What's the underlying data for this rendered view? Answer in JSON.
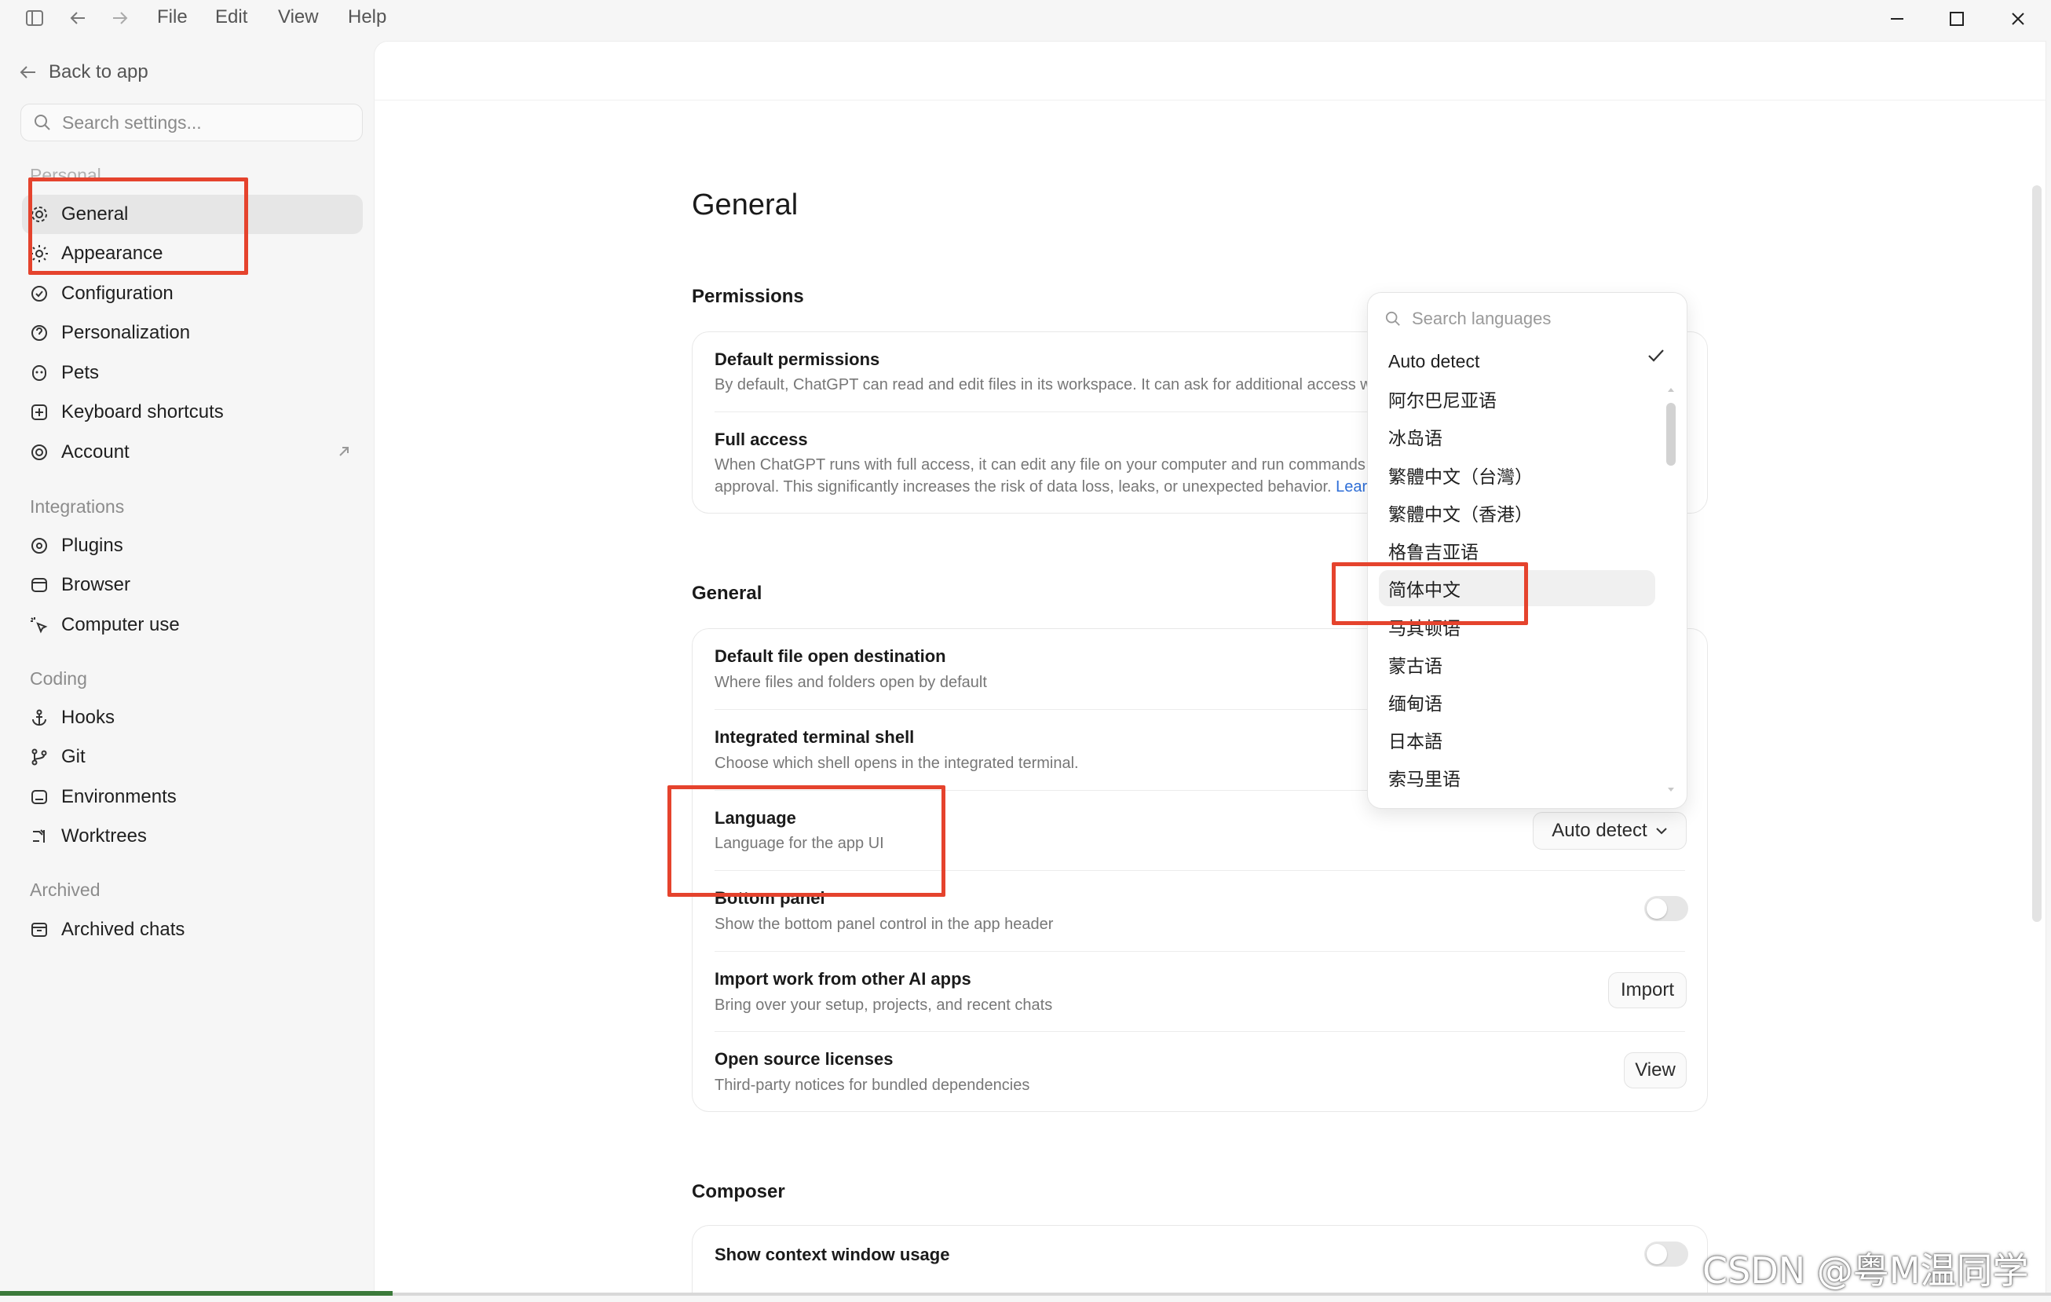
{
  "menu": {
    "file": "File",
    "edit": "Edit",
    "view": "View",
    "help": "Help"
  },
  "sidebar": {
    "back_label": "Back to app",
    "search_placeholder": "Search settings...",
    "sections": {
      "personal": "Personal",
      "integrations": "Integrations",
      "coding": "Coding",
      "archived": "Archived"
    },
    "items": {
      "general": "General",
      "appearance": "Appearance",
      "configuration": "Configuration",
      "personalization": "Personalization",
      "pets": "Pets",
      "keyboard_shortcuts": "Keyboard shortcuts",
      "account": "Account",
      "plugins": "Plugins",
      "browser": "Browser",
      "computer_use": "Computer use",
      "hooks": "Hooks",
      "git": "Git",
      "environments": "Environments",
      "worktrees": "Worktrees",
      "archived_chats": "Archived chats"
    }
  },
  "main": {
    "title": "General",
    "permissions": {
      "heading": "Permissions",
      "default_title": "Default permissions",
      "default_desc": "By default, ChatGPT can read and edit files in its workspace. It can ask for additional access wh",
      "full_title": "Full access",
      "full_desc_1": "When ChatGPT runs with full access, it can edit any file on your computer and run commands",
      "full_desc_2": "approval. This significantly increases the risk of data loss, leaks, or unexpected behavior.",
      "full_link": "Learn"
    },
    "general": {
      "heading": "General",
      "rows": [
        {
          "title": "Default file open destination",
          "desc": "Where files and folders open by default"
        },
        {
          "title": "Integrated terminal shell",
          "desc": "Choose which shell opens in the integrated terminal."
        },
        {
          "title": "Language",
          "desc": "Language for the app UI",
          "control": "Auto detect"
        },
        {
          "title": "Bottom panel",
          "desc": "Show the bottom panel control in the app header"
        },
        {
          "title": "Import work from other AI apps",
          "desc": "Bring over your setup, projects, and recent chats",
          "control": "Import"
        },
        {
          "title": "Open source licenses",
          "desc": "Third-party notices for bundled dependencies",
          "control": "View"
        }
      ]
    },
    "composer": {
      "heading": "Composer",
      "rows": [
        {
          "title": "Show context window usage"
        }
      ]
    }
  },
  "language_dropdown": {
    "search_placeholder": "Search languages",
    "selected": "Auto detect",
    "options": [
      "Auto detect",
      "阿尔巴尼亚语",
      "冰岛语",
      "繁體中文（台灣）",
      "繁體中文（香港）",
      "格鲁吉亚语",
      "简体中文",
      "马其顿语",
      "蒙古语",
      "缅甸语",
      "日本語",
      "索马里语"
    ],
    "hovered": "简体中文"
  },
  "watermark": "CSDN @粤M温同学",
  "colors": {
    "highlight": "#e5432d",
    "link": "#2f6fd8",
    "active_bg": "#e6e6e6"
  }
}
